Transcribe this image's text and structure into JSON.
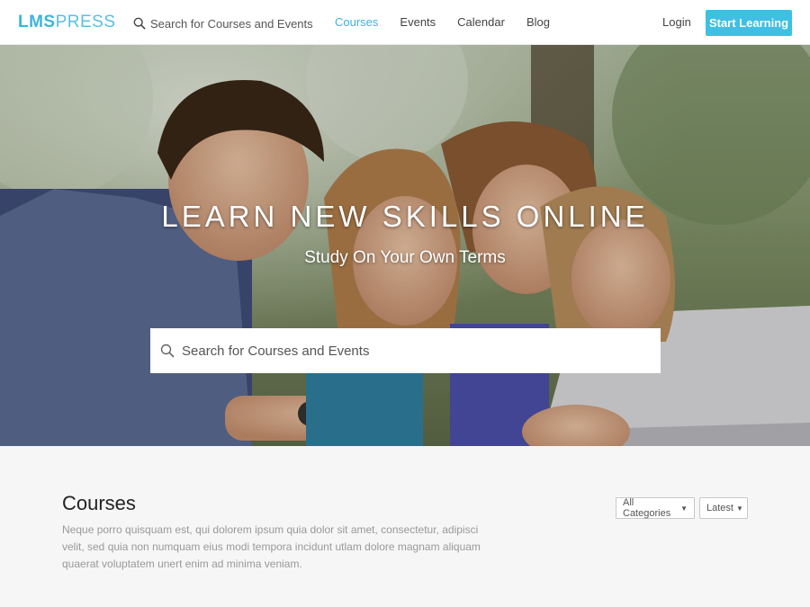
{
  "header": {
    "logo_bold": "LMS",
    "logo_light": "PRESS",
    "search_placeholder": "Search for Courses and Events",
    "nav": [
      {
        "label": "Courses",
        "active": true
      },
      {
        "label": "Events",
        "active": false
      },
      {
        "label": "Calendar",
        "active": false
      },
      {
        "label": "Blog",
        "active": false
      }
    ],
    "login_label": "Login",
    "cta_label": "Start Learning"
  },
  "hero": {
    "title": "LEARN NEW SKILLS ONLINE",
    "subtitle": "Study On Your Own Terms",
    "search_placeholder": "Search for Courses and Events"
  },
  "courses": {
    "title": "Courses",
    "description": "Neque porro quisquam est, qui dolorem ipsum quia dolor sit amet, consectetur, adipisci velit, sed quia non numquam eius modi tempora incidunt utlam dolore magnam aliquam quaerat voluptatem unert enim ad minima veniam.",
    "filter_category": "All Categories",
    "filter_sort": "Latest"
  },
  "colors": {
    "accent": "#3bb5dc",
    "cta": "#3ec0e4"
  }
}
